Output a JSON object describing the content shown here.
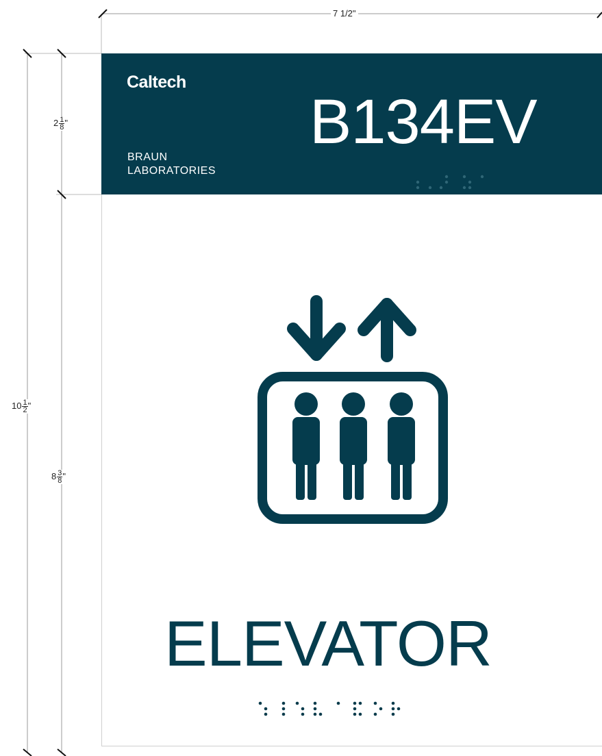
{
  "dimensions": {
    "width": "7 1/2\"",
    "total_height": {
      "whole": "10",
      "num": "1",
      "den": "2"
    },
    "header_height": {
      "whole": "2",
      "num": "1",
      "den": "8"
    },
    "body_height": {
      "whole": "8",
      "num": "3",
      "den": "8"
    }
  },
  "sign": {
    "brand": "Caltech",
    "building_line1": "BRAUN",
    "building_line2": "LABORATORIES",
    "room_number": "B134EV",
    "room_label": "ELEVATOR",
    "icon": "elevator-icon",
    "colors": {
      "header_bg": "#053c4d",
      "accent": "#053c4d",
      "braille_dot": "#0a3c4c"
    }
  }
}
